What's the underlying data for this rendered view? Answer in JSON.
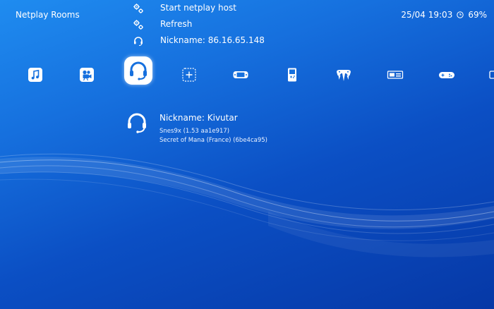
{
  "header": {
    "title": "Netplay Rooms",
    "datetime": "25/04 19:03",
    "battery": "69%"
  },
  "menu": {
    "items": [
      {
        "label": "Start netplay host",
        "icon": "gears-icon"
      },
      {
        "label": "Refresh",
        "icon": "gears-icon"
      },
      {
        "label": "Nickname: 86.16.65.148",
        "icon": "headset-icon"
      }
    ]
  },
  "tabs": [
    {
      "name": "music-icon"
    },
    {
      "name": "video-icon"
    },
    {
      "name": "netplay-icon",
      "active": true
    },
    {
      "name": "add-icon"
    },
    {
      "name": "handheld-console-icon"
    },
    {
      "name": "gameboy-icon"
    },
    {
      "name": "n64-controller-icon"
    },
    {
      "name": "nes-console-icon"
    },
    {
      "name": "snes-controller-icon"
    }
  ],
  "room": {
    "nickname": "Nickname: Kivutar",
    "core": "Snes9x (1.53 aa1e917)",
    "game": "Secret of Mana (France) (6be4ca95)"
  },
  "colors": {
    "bg_top": "#1f8cf0",
    "bg_bottom": "#0638a6",
    "text": "#ffffff"
  }
}
